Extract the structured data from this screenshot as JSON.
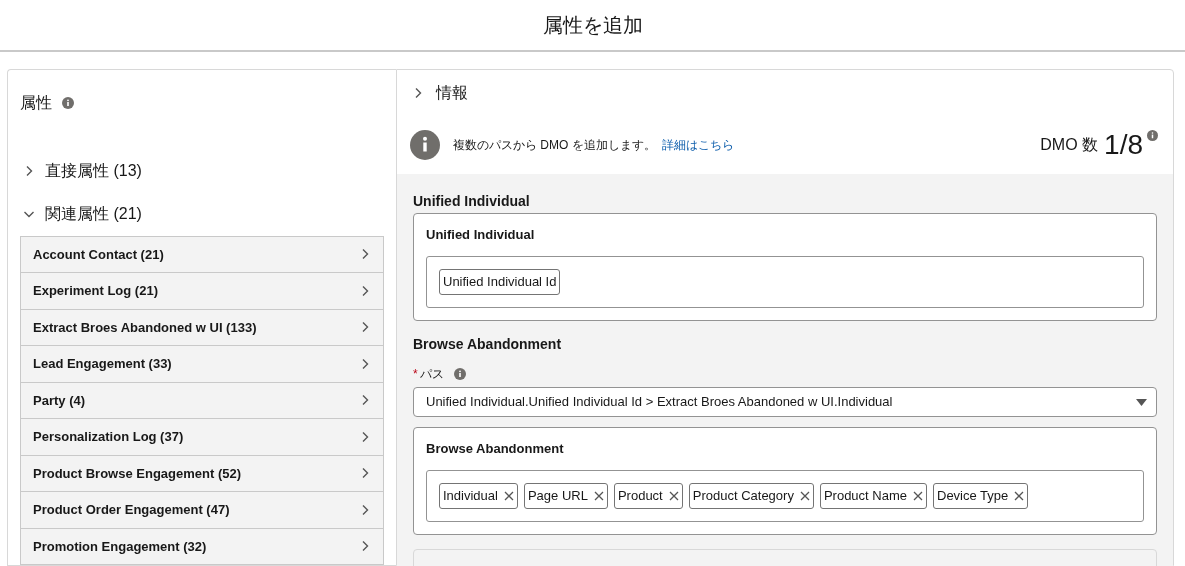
{
  "header": {
    "title": "属性を追加"
  },
  "attributes_panel": {
    "title": "属性",
    "groups": [
      {
        "label": "直接属性 (13)",
        "expanded": false
      },
      {
        "label": "関連属性 (21)",
        "expanded": true,
        "items": [
          {
            "label": "Account Contact (21)"
          },
          {
            "label": "Experiment Log (21)"
          },
          {
            "label": "Extract Broes Abandoned w UI (133)"
          },
          {
            "label": "Lead Engagement (33)"
          },
          {
            "label": "Party (4)"
          },
          {
            "label": "Personalization Log (37)"
          },
          {
            "label": "Product Browse Engagement (52)"
          },
          {
            "label": "Product Order Engagement (47)"
          },
          {
            "label": "Promotion Engagement (32)"
          }
        ]
      }
    ]
  },
  "info_section": {
    "label": "情報",
    "expanded": false
  },
  "notice": {
    "text": "複数のパスから DMO を追加します。",
    "link": "詳細はこちら"
  },
  "dmo_count": {
    "label": "DMO 数",
    "value": "1/8"
  },
  "sections": [
    {
      "title": "Unified Individual",
      "card": {
        "title": "Unified Individual",
        "chips": [
          {
            "label": "Unified Individual Id",
            "removable": false
          }
        ]
      }
    },
    {
      "title": "Browse Abandonment",
      "path": {
        "label": "パス",
        "required_mark": "*",
        "value": "Unified Individual.Unified Individual Id > Extract Broes Abandoned w UI.Individual"
      },
      "card": {
        "title": "Browse Abandonment",
        "chips": [
          {
            "label": "Individual",
            "removable": true
          },
          {
            "label": "Page URL",
            "removable": true
          },
          {
            "label": "Product",
            "removable": true
          },
          {
            "label": "Product Category",
            "removable": true
          },
          {
            "label": "Product Name",
            "removable": true
          },
          {
            "label": "Device Type",
            "removable": true
          }
        ]
      }
    }
  ]
}
